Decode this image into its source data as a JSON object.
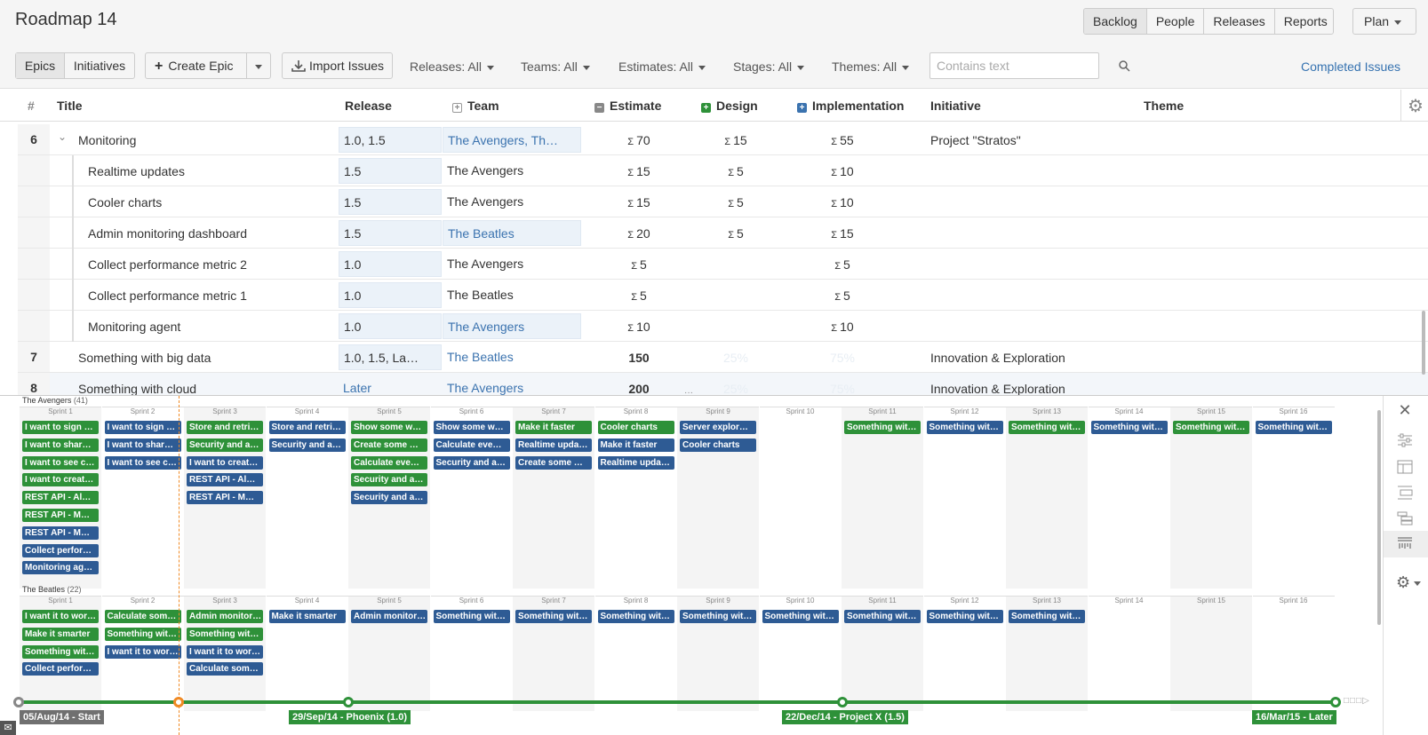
{
  "app": {
    "title": "Roadmap 14",
    "nav": [
      "Backlog",
      "People",
      "Releases",
      "Reports"
    ],
    "plan_label": "Plan"
  },
  "toolbar": {
    "tabs": [
      "Epics",
      "Initiatives"
    ],
    "create_epic": "Create Epic",
    "import_issues": "Import Issues",
    "filters": {
      "releases": "Releases: All",
      "teams": "Teams: All",
      "estimates": "Estimates: All",
      "stages": "Stages: All",
      "themes": "Themes: All"
    },
    "search_placeholder": "Contains text",
    "completed_issues": "Completed Issues"
  },
  "table": {
    "headers": {
      "num": "#",
      "title": "Title",
      "release": "Release",
      "team": "Team",
      "estimate": "Estimate",
      "design": "Design",
      "implementation": "Implementation",
      "initiative": "Initiative",
      "theme": "Theme"
    },
    "rows": [
      {
        "num": "6",
        "title": "Monitoring",
        "release": "1.0, 1.5",
        "team": "The Avengers, Th…",
        "estimate": "70",
        "design": "15",
        "impl": "55",
        "initiative": "Project \"Stratos\""
      },
      {
        "num": "",
        "title": "Realtime updates",
        "release": "1.5",
        "team": "The Avengers",
        "estimate": "15",
        "design": "5",
        "impl": "10",
        "initiative": ""
      },
      {
        "num": "",
        "title": "Cooler charts",
        "release": "1.5",
        "team": "The Avengers",
        "estimate": "15",
        "design": "5",
        "impl": "10",
        "initiative": ""
      },
      {
        "num": "",
        "title": "Admin monitoring dashboard",
        "release": "1.5",
        "team": "The Beatles",
        "estimate": "20",
        "design": "5",
        "impl": "15",
        "initiative": ""
      },
      {
        "num": "",
        "title": "Collect performance metric 2",
        "release": "1.0",
        "team": "The Avengers",
        "estimate": "5",
        "design": "",
        "impl": "5",
        "initiative": ""
      },
      {
        "num": "",
        "title": "Collect performance metric 1",
        "release": "1.0",
        "team": "The Beatles",
        "estimate": "5",
        "design": "",
        "impl": "5",
        "initiative": ""
      },
      {
        "num": "",
        "title": "Monitoring agent",
        "release": "1.0",
        "team": "The Avengers",
        "estimate": "10",
        "design": "",
        "impl": "10",
        "initiative": ""
      },
      {
        "num": "7",
        "title": "Something with big data",
        "release": "1.0, 1.5, La…",
        "team": "The Beatles",
        "estimate": "150",
        "design": "25%",
        "impl": "75%",
        "initiative": "Innovation & Exploration"
      },
      {
        "num": "8",
        "title": "Something with cloud",
        "release": "Later",
        "team": "The Avengers",
        "estimate": "200",
        "design": "25%",
        "impl": "75%",
        "initiative": "Innovation & Exploration"
      }
    ]
  },
  "planner": {
    "sprints": [
      "Sprint 1",
      "Sprint 2",
      "Sprint 3",
      "Sprint 4",
      "Sprint 5",
      "Sprint 6",
      "Sprint 7",
      "Sprint 8",
      "Sprint 9",
      "Sprint 10",
      "Sprint 11",
      "Sprint 12",
      "Sprint 13",
      "Sprint 14",
      "Sprint 15",
      "Sprint 16"
    ],
    "teams": [
      {
        "name": "The Avengers",
        "count": "(41)",
        "columns": [
          [
            [
              "I want to sign …",
              "g"
            ],
            [
              "I want to shar…",
              "g"
            ],
            [
              "I want to see c…",
              "g"
            ],
            [
              "I want to creat…",
              "g"
            ],
            [
              "REST API - Al…",
              "g"
            ],
            [
              "REST API - M…",
              "g"
            ],
            [
              "REST API - M…",
              "b"
            ],
            [
              "Collect perfor…",
              "b"
            ],
            [
              "Monitoring ag…",
              "b"
            ]
          ],
          [
            [
              "I want to sign …",
              "b"
            ],
            [
              "I want to shar…",
              "b"
            ],
            [
              "I want to see c…",
              "b"
            ]
          ],
          [
            [
              "Store and retri…",
              "g"
            ],
            [
              "Security and a…",
              "g"
            ],
            [
              "I want to creat…",
              "b"
            ],
            [
              "REST API - Al…",
              "b"
            ],
            [
              "REST API - M…",
              "b"
            ]
          ],
          [
            [
              "Store and retri…",
              "b"
            ],
            [
              "Security and a…",
              "b"
            ]
          ],
          [
            [
              "Show some w…",
              "g"
            ],
            [
              "Create some …",
              "g"
            ],
            [
              "Calculate eve…",
              "g"
            ],
            [
              "Security and a…",
              "g"
            ],
            [
              "Security and a…",
              "b"
            ]
          ],
          [
            [
              "Show some w…",
              "b"
            ],
            [
              "Calculate eve…",
              "b"
            ],
            [
              "Security and a…",
              "b"
            ]
          ],
          [
            [
              "Make it faster",
              "g"
            ],
            [
              "Realtime upda…",
              "b"
            ],
            [
              "Create some …",
              "b"
            ]
          ],
          [
            [
              "Cooler charts",
              "g"
            ],
            [
              "Make it faster",
              "b"
            ],
            [
              "Realtime upda…",
              "b"
            ]
          ],
          [
            [
              "Server explor…",
              "b"
            ],
            [
              "Cooler charts",
              "b"
            ]
          ],
          [],
          [
            [
              "Something wit…",
              "g"
            ]
          ],
          [
            [
              "Something wit…",
              "b"
            ]
          ],
          [
            [
              "Something wit…",
              "g"
            ]
          ],
          [
            [
              "Something wit…",
              "b"
            ]
          ],
          [
            [
              "Something wit…",
              "g"
            ]
          ],
          [
            [
              "Something wit…",
              "b"
            ]
          ]
        ]
      },
      {
        "name": "The Beatles",
        "count": "(22)",
        "columns": [
          [
            [
              "I want it to wor…",
              "g"
            ],
            [
              "Make it smarter",
              "g"
            ],
            [
              "Something wit…",
              "g"
            ],
            [
              "Collect perfor…",
              "b"
            ]
          ],
          [
            [
              "Calculate som…",
              "g"
            ],
            [
              "Something wit…",
              "g"
            ],
            [
              "I want it to wor…",
              "b"
            ]
          ],
          [
            [
              "Admin monitor…",
              "g"
            ],
            [
              "Something wit…",
              "g"
            ],
            [
              "I want it to wor…",
              "b"
            ],
            [
              "Calculate som…",
              "b"
            ]
          ],
          [
            [
              "Make it smarter",
              "b"
            ]
          ],
          [
            [
              "Admin monitor…",
              "b"
            ]
          ],
          [
            [
              "Something wit…",
              "b"
            ]
          ],
          [
            [
              "Something wit…",
              "b"
            ]
          ],
          [
            [
              "Something wit…",
              "b"
            ]
          ],
          [
            [
              "Something wit…",
              "b"
            ]
          ],
          [
            [
              "Something wit…",
              "b"
            ]
          ],
          [
            [
              "Something wit…",
              "b"
            ]
          ],
          [
            [
              "Something wit…",
              "b"
            ]
          ],
          [
            [
              "Something wit…",
              "b"
            ]
          ],
          [],
          [],
          []
        ]
      }
    ],
    "releases": [
      {
        "label": "05/Aug/14 - Start",
        "color": "#707070"
      },
      {
        "label": "29/Sep/14 - Phoenix (1.0)",
        "color": "#2e9139"
      },
      {
        "label": "22/Dec/14 - Project X (1.5)",
        "color": "#2e9139"
      },
      {
        "label": "16/Mar/15 - Later",
        "color": "#2e9139"
      }
    ],
    "accent_green": "#2e9139",
    "accent_blue": "#2e5b94",
    "today_color": "#f08a24"
  }
}
